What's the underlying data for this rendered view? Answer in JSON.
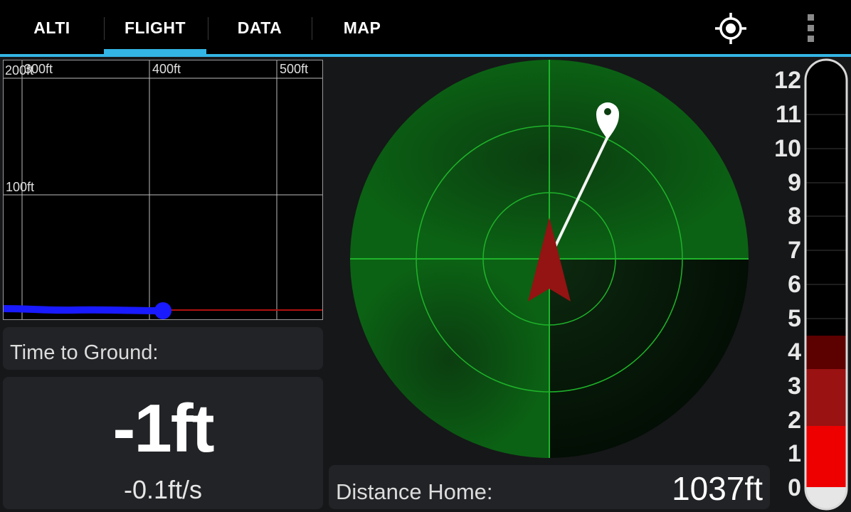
{
  "tabs": [
    {
      "label": "ALTI"
    },
    {
      "label": "FLIGHT",
      "active": true
    },
    {
      "label": "DATA"
    },
    {
      "label": "MAP"
    }
  ],
  "actions": {
    "locate_icon": "crosshair-icon",
    "menu_icon": "overflow-menu-icon"
  },
  "colors": {
    "accent": "#33b5e5",
    "radar_green": "#0a5a12",
    "alert_red": "#ee0000",
    "track_blue": "#1a1aff"
  },
  "graph": {
    "x_labels": [
      "200ft",
      "300ft",
      "400ft",
      "500ft"
    ],
    "y_labels": [
      "100ft"
    ],
    "current_altitude_ft": -1
  },
  "time_to_ground": {
    "label": "Time to Ground:"
  },
  "altitude": {
    "value": "-1ft",
    "rate": "-0.1ft/s"
  },
  "distance_home": {
    "label": "Distance Home:",
    "value": "1037ft"
  },
  "scale": {
    "labels": [
      "12",
      "11",
      "10",
      "9",
      "8",
      "7",
      "6",
      "5",
      "4",
      "3",
      "2",
      "1",
      "0"
    ]
  }
}
